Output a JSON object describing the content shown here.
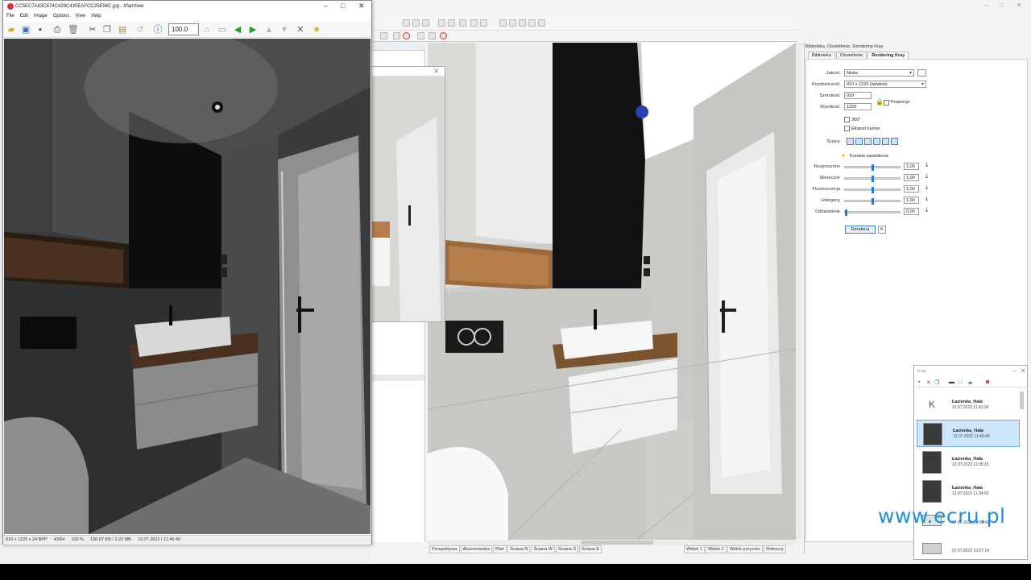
{
  "irfanview": {
    "title": "CC5EC7A83C674C429C430EAFCC25E96C.jpg - IrfanView",
    "menu": [
      "File",
      "Edit",
      "Image",
      "Options",
      "View",
      "Help"
    ],
    "zoom_value": "100.0",
    "status": [
      "910 x 1229 x 24 BPP",
      "43/64",
      "100 %",
      "130.07 KB / 3.20 MB",
      "12.07.2022 / 11:40:49"
    ],
    "controls": {
      "minimize": "–",
      "maximize": "□",
      "close": "✕"
    }
  },
  "kray_panel": {
    "title": "Biblioteka, Oświetlenie, Rendering Kray",
    "tabs": [
      "Biblioteka",
      "Oświetlenie",
      "Rendering Kray"
    ],
    "active_tab": "Rendering Kray",
    "quality_label": "Jakość",
    "quality_value": "Niska",
    "resolution_label": "Rozdzielczość",
    "resolution_value": "910 x 1229 (window)",
    "width_label": "Szerokość",
    "width_value": "910",
    "height_label": "Wysokość",
    "height_value": "1229",
    "proportions_label": "Proporcje",
    "opt_360": "360°",
    "export_cameras": "Eksport kamer",
    "walls_label": "Ściany",
    "light_correction": "Korekta oświetlenia",
    "sliders": [
      {
        "label": "Rozproszone",
        "value": "1,00",
        "level": 0.5
      },
      {
        "label": "Słoneczne",
        "value": "1,00",
        "level": 0.5
      },
      {
        "label": "Fluorescencja",
        "value": "1,00",
        "level": 0.5
      },
      {
        "label": "Halogeny",
        "value": "1,00",
        "level": 0.5
      },
      {
        "label": "Odbarwienie",
        "value": "0,00",
        "level": 0.0
      }
    ],
    "render_button": "Renderuj"
  },
  "history": {
    "title": "Kray",
    "items": [
      {
        "name": "Łazienka_Hała",
        "date": "12.07.2022 11:41:24",
        "selected": false
      },
      {
        "name": "Łazienka_Hała",
        "date": "12.07.2022 11:40:49",
        "selected": true
      },
      {
        "name": "Łazienka_Hała",
        "date": "12.07.2022 11:35:15",
        "selected": false
      },
      {
        "name": "Łazienka_Hała",
        "date": "12.07.2022 11:34:03",
        "selected": false
      },
      {
        "name": "",
        "date": "07.07.2022 10:55:41",
        "selected": false
      },
      {
        "name": "",
        "date": "07.07.2022 10:37:14",
        "selected": false
      }
    ]
  },
  "viewport_tabs": [
    "Perspektywa",
    "Aksonometria",
    "Plan",
    "Ściana N",
    "Ściana W",
    "Ściana S",
    "Ściana E"
  ],
  "viewport_tabs_right": [
    "Widok 1",
    "Widok 2",
    "Widok przyzmic",
    "Roboczy"
  ],
  "watermark": "www.ecru.pl"
}
